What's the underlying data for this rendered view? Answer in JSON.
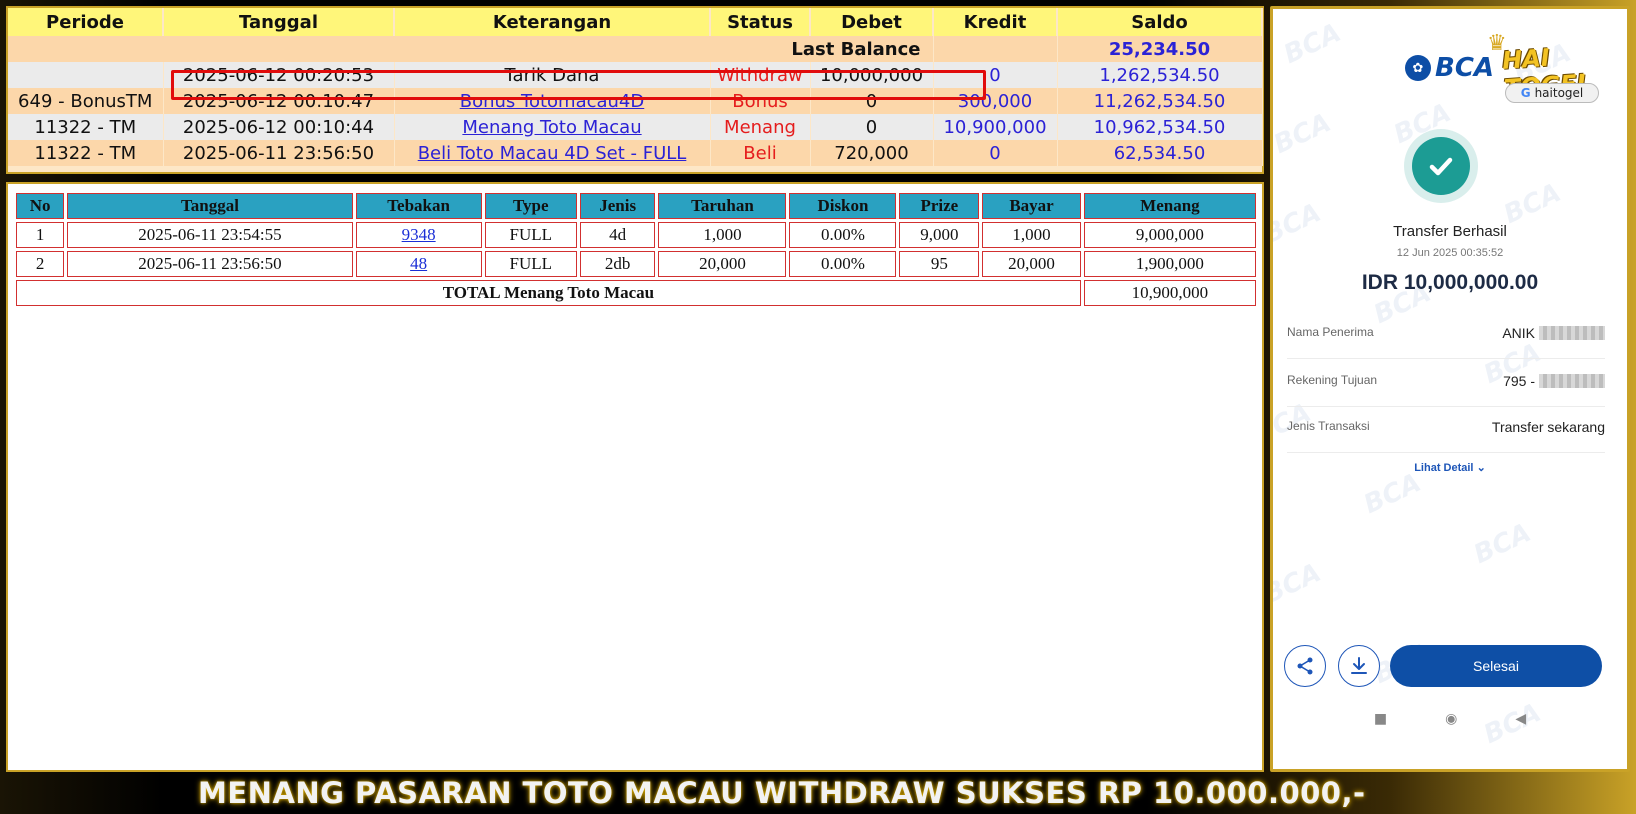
{
  "ledger": {
    "headers": [
      "Periode",
      "Tanggal",
      "Keterangan",
      "Status",
      "Debet",
      "Kredit",
      "Saldo"
    ],
    "last_balance_label": "Last Balance",
    "last_balance_value": "25,234.50",
    "rows": [
      {
        "periode": "",
        "tanggal": "2025-06-12 00:20:53",
        "keterangan": "Tarik Dana",
        "status": "Withdraw",
        "debet": "10,000,000",
        "kredit": "0",
        "saldo": "1,262,534.50"
      },
      {
        "periode": "649 - BonusTM",
        "tanggal": "2025-06-12 00:10:47",
        "keterangan": "Bonus Totomacau4D",
        "status": "Bonus",
        "debet": "0",
        "kredit": "300,000",
        "saldo": "11,262,534.50"
      },
      {
        "periode": "11322 - TM",
        "tanggal": "2025-06-12 00:10:44",
        "keterangan": "Menang Toto Macau",
        "status": "Menang",
        "debet": "0",
        "kredit": "10,900,000",
        "saldo": "10,962,534.50"
      },
      {
        "periode": "11322 - TM",
        "tanggal": "2025-06-11 23:56:50",
        "keterangan": "Beli Toto Macau 4D Set - FULL",
        "status": "Beli",
        "debet": "720,000",
        "kredit": "0",
        "saldo": "62,534.50"
      }
    ]
  },
  "bets": {
    "headers": [
      "No",
      "Tanggal",
      "Tebakan",
      "Type",
      "Jenis",
      "Taruhan",
      "Diskon",
      "Prize",
      "Bayar",
      "Menang"
    ],
    "rows": [
      {
        "no": "1",
        "tanggal": "2025-06-11 23:54:55",
        "tebakan": "9348",
        "type": "FULL",
        "jenis": "4d",
        "taruhan": "1,000",
        "diskon": "0.00%",
        "prize": "9,000",
        "bayar": "1,000",
        "menang": "9,000,000"
      },
      {
        "no": "2",
        "tanggal": "2025-06-11 23:56:50",
        "tebakan": "48",
        "type": "FULL",
        "jenis": "2db",
        "taruhan": "20,000",
        "diskon": "0.00%",
        "prize": "95",
        "bayar": "20,000",
        "menang": "1,900,000"
      }
    ],
    "total_label": "TOTAL  Menang Toto Macau",
    "total_value": "10,900,000"
  },
  "phone": {
    "bank_logo": "BCA",
    "brand_name": "HAI TOGEL",
    "brand_pill": "haitogel",
    "watermark": "BCA",
    "title": "Transfer Berhasil",
    "timestamp": "12 Jun 2025 00:35:52",
    "amount": "IDR 10,000,000.00",
    "details": [
      {
        "label": "Nama Penerima",
        "value": "ANIK"
      },
      {
        "label": "Rekening Tujuan",
        "value": "795 -"
      },
      {
        "label": "Jenis Transaksi",
        "value": "Transfer sekarang"
      }
    ],
    "lihat_detail": "Lihat Detail",
    "done_button": "Selesai",
    "icons": {
      "share": "share-icon",
      "download": "download-icon",
      "success": "check-icon"
    }
  },
  "banner": {
    "text": "MENANG PASARAN TOTO MACAU WITHDRAW SUKSES RP 10.000.000,-"
  },
  "colors": {
    "gold": "#c9a227",
    "header_yellow": "#fff67a",
    "link_blue": "#2b22d6",
    "status_red": "#e51d1d",
    "table_header_teal": "#2aa1c1",
    "bca_blue": "#0e4fa6",
    "success_teal": "#1c9c94"
  }
}
